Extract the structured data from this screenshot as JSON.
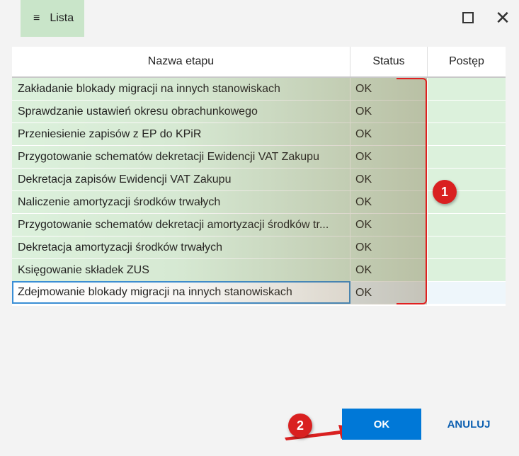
{
  "window": {
    "menu_label": "Lista",
    "hamburger_glyph": "≡",
    "close_glyph": "✕"
  },
  "table": {
    "columns": [
      "Nazwa etapu",
      "Status",
      "Postęp"
    ],
    "rows": [
      {
        "name": "Zakładanie blokady migracji na innych stanowiskach",
        "status": "OK",
        "progress": ""
      },
      {
        "name": "Sprawdzanie ustawień okresu obrachunkowego",
        "status": "OK",
        "progress": ""
      },
      {
        "name": "Przeniesienie zapisów z EP do KPiR",
        "status": "OK",
        "progress": ""
      },
      {
        "name": "Przygotowanie schematów dekretacji Ewidencji VAT Zakupu",
        "status": "OK",
        "progress": ""
      },
      {
        "name": "Dekretacja zapisów Ewidencji VAT Zakupu",
        "status": "OK",
        "progress": ""
      },
      {
        "name": "Naliczenie amortyzacji środków trwałych",
        "status": "OK",
        "progress": ""
      },
      {
        "name": "Przygotowanie schematów dekretacji amortyzacji środków tr...",
        "status": "OK",
        "progress": ""
      },
      {
        "name": "Dekretacja amortyzacji środków trwałych",
        "status": "OK",
        "progress": ""
      },
      {
        "name": "Księgowanie składek ZUS",
        "status": "OK",
        "progress": ""
      },
      {
        "name": "Zdejmowanie blokady migracji na innych stanowiskach",
        "status": "OK",
        "progress": ""
      }
    ]
  },
  "annotations": {
    "badge_1": "1",
    "badge_2": "2"
  },
  "buttons": {
    "ok_label": "OK",
    "cancel_label": "ANULUJ"
  },
  "colors": {
    "row_done": "#dcf1dc",
    "accent": "#0078d7",
    "annotation": "#d92020"
  }
}
